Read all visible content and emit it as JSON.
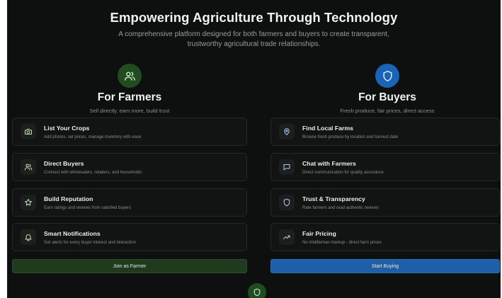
{
  "hero": {
    "title": "Empowering Agriculture Through Technology",
    "subtitle_line1": "A comprehensive platform designed for both farmers and buyers to create transparent,",
    "subtitle_line2": "trustworthy agricultural trade relationships."
  },
  "farmers": {
    "icon": "users-icon",
    "title": "For Farmers",
    "subtitle": "Sell directly, earn more, build trust",
    "accent": "#214c20",
    "features": [
      {
        "icon": "camera-icon",
        "title": "List Your Crops",
        "desc": "Add photos, set prices, manage inventory with ease"
      },
      {
        "icon": "users-icon",
        "title": "Direct Buyers",
        "desc": "Connect with wholesalers, retailers, and households"
      },
      {
        "icon": "star-icon",
        "title": "Build Reputation",
        "desc": "Earn ratings and reviews from satisfied buyers"
      },
      {
        "icon": "bell-icon",
        "title": "Smart Notifications",
        "desc": "Get alerts for every buyer interest and interaction"
      }
    ],
    "cta": "Join as Farmer"
  },
  "buyers": {
    "icon": "shield-icon",
    "title": "For Buyers",
    "subtitle": "Fresh produce, fair prices, direct access",
    "accent": "#1a64b8",
    "features": [
      {
        "icon": "map-pin-icon",
        "title": "Find Local Farms",
        "desc": "Browse fresh produce by location and harvest date"
      },
      {
        "icon": "chat-icon",
        "title": "Chat with Farmers",
        "desc": "Direct communication for quality assurance"
      },
      {
        "icon": "shield-icon",
        "title": "Trust & Transparency",
        "desc": "Rate farmers and read authentic reviews"
      },
      {
        "icon": "trending-up-icon",
        "title": "Fair Pricing",
        "desc": "No middleman markup - direct farm prices"
      }
    ],
    "cta": "Start Buying"
  },
  "footer": {
    "icon": "shield-icon"
  }
}
